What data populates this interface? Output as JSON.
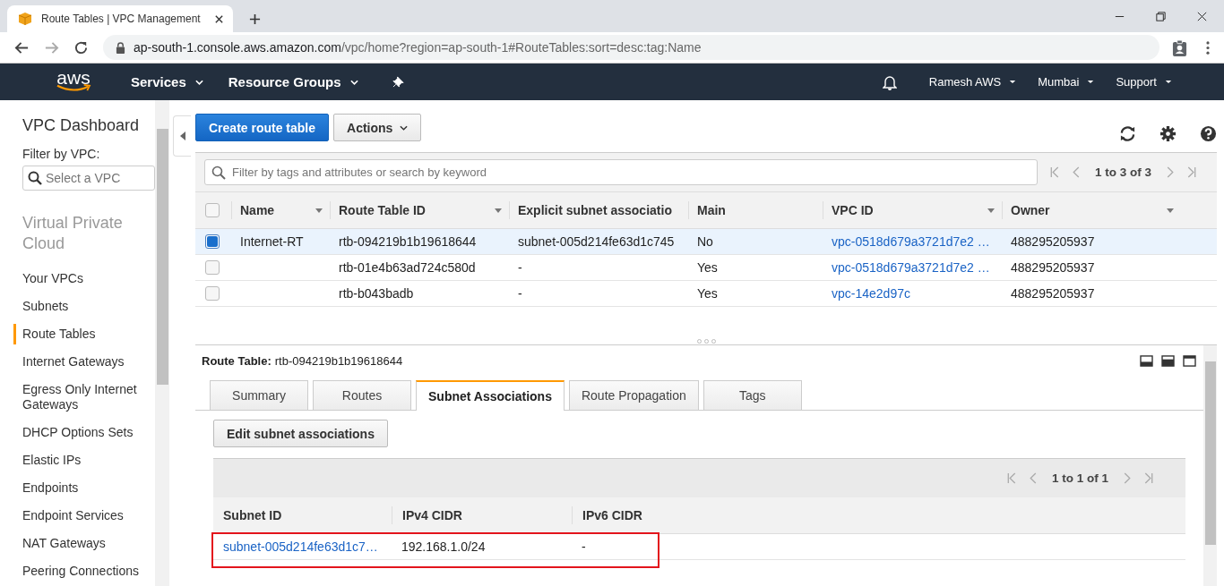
{
  "browser": {
    "tab_title": "Route Tables | VPC Management",
    "url_host": "ap-south-1.console.aws.amazon.com",
    "url_path": "/vpc/home?region=ap-south-1#RouteTables:sort=desc:tag:Name"
  },
  "nav": {
    "logo": "aws",
    "menus": [
      "Services",
      "Resource Groups"
    ],
    "right_menus": [
      "Ramesh AWS",
      "Mumbai",
      "Support"
    ]
  },
  "sidebar": {
    "title": "VPC Dashboard",
    "filter_label": "Filter by VPC:",
    "filter_placeholder": "Select a VPC",
    "section": "Virtual Private Cloud",
    "items": [
      {
        "label": "Your VPCs",
        "selected": false
      },
      {
        "label": "Subnets",
        "selected": false
      },
      {
        "label": "Route Tables",
        "selected": true
      },
      {
        "label": "Internet Gateways",
        "selected": false
      },
      {
        "label": "Egress Only Internet Gateways",
        "selected": false
      },
      {
        "label": "DHCP Options Sets",
        "selected": false
      },
      {
        "label": "Elastic IPs",
        "selected": false
      },
      {
        "label": "Endpoints",
        "selected": false
      },
      {
        "label": "Endpoint Services",
        "selected": false
      },
      {
        "label": "NAT Gateways",
        "selected": false
      },
      {
        "label": "Peering Connections",
        "selected": false
      }
    ]
  },
  "toolbar": {
    "create_button": "Create route table",
    "actions_button": "Actions"
  },
  "search": {
    "placeholder": "Filter by tags and attributes or search by keyword"
  },
  "pager": "1 to 3 of 3",
  "table": {
    "all_selected": false,
    "columns": [
      {
        "label": "Name",
        "sortable": true
      },
      {
        "label": "Route Table ID",
        "sortable": true
      },
      {
        "label": "Explicit subnet associatio",
        "sortable": false
      },
      {
        "label": "Main",
        "sortable": false
      },
      {
        "label": "VPC ID",
        "sortable": true
      },
      {
        "label": "Owner",
        "sortable": true
      }
    ],
    "rows": [
      {
        "selected": true,
        "name": "Internet-RT",
        "route_table_id": "rtb-094219b1b19618644",
        "subnet_association": "subnet-005d214fe63d1c745",
        "main": "No",
        "vpc_id": "vpc-0518d679a3721d7e2 …",
        "owner": "488295205937"
      },
      {
        "selected": false,
        "name": "",
        "route_table_id": "rtb-01e4b63ad724c580d",
        "subnet_association": "-",
        "main": "Yes",
        "vpc_id": "vpc-0518d679a3721d7e2 …",
        "owner": "488295205937"
      },
      {
        "selected": false,
        "name": "",
        "route_table_id": "rtb-b043badb",
        "subnet_association": "-",
        "main": "Yes",
        "vpc_id": "vpc-14e2d97c",
        "owner": "488295205937"
      }
    ]
  },
  "details": {
    "label": "Route Table:",
    "value": "rtb-094219b1b19618644",
    "tabs": [
      {
        "label": "Summary",
        "selected": false
      },
      {
        "label": "Routes",
        "selected": false
      },
      {
        "label": "Subnet Associations",
        "selected": true
      },
      {
        "label": "Route Propagation",
        "selected": false
      },
      {
        "label": "Tags",
        "selected": false
      }
    ],
    "edit_button": "Edit subnet associations",
    "pager": "1 to 1 of 1",
    "columns": [
      "Subnet ID",
      "IPv4 CIDR",
      "IPv6 CIDR"
    ],
    "rows": [
      {
        "subnet_id": "subnet-005d214fe63d1c7…",
        "ipv4_cidr": "192.168.1.0/24",
        "ipv6_cidr": "-",
        "highlighted": true
      }
    ]
  }
}
